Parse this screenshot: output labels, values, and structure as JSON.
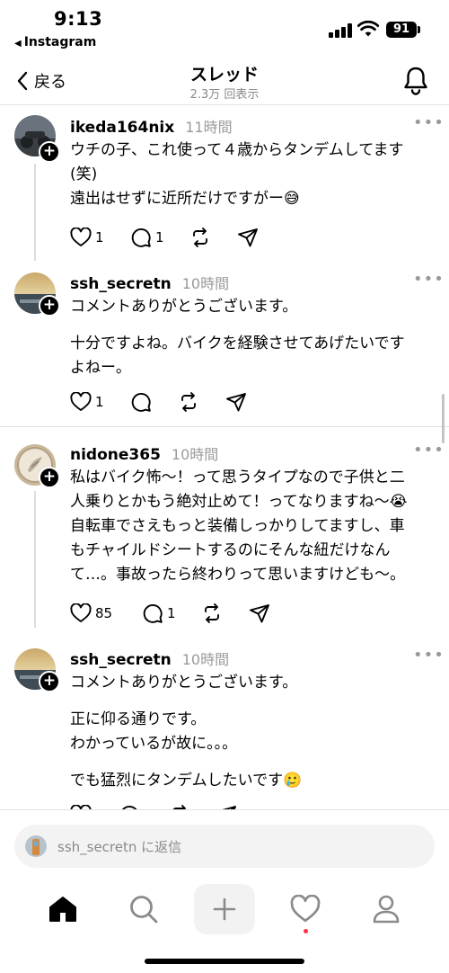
{
  "status_bar": {
    "time": "9:13",
    "back_app": "Instagram",
    "battery": "91"
  },
  "header": {
    "back_label": "戻る",
    "title": "スレッド",
    "views": "2.3万 回表示"
  },
  "posts": [
    {
      "username": "ikeda164nix",
      "time": "11時間",
      "lines": [
        "ウチの子、これ使って４歳からタンデムしてます",
        "(笑)",
        "遠出はせずに近所だけですがー😅"
      ],
      "likes": "1",
      "replies": "1"
    },
    {
      "username": "ssh_secretn",
      "time": "10時間",
      "lines": [
        "コメントありがとうございます。",
        "",
        "十分ですよね。バイクを経験させてあげたいです",
        "よねー。"
      ],
      "likes": "1",
      "replies": ""
    },
    {
      "username": "nidone365",
      "time": "10時間",
      "lines": [
        "私はバイク怖〜！って思うタイプなので子供と二",
        "人乗りとかもう絶対止めて！ってなりますね〜😭",
        "自転車でさえもっと装備しっかりしてますし、車",
        "もチャイルドシートするのにそんな紐だけなん",
        "て…。事故ったら終わりって思いますけども〜。"
      ],
      "likes": "85",
      "replies": "1"
    },
    {
      "username": "ssh_secretn",
      "time": "10時間",
      "lines": [
        "コメントありがとうございます。",
        "",
        "正に仰る通りです。",
        "わかっているが故に。。。",
        "",
        "でも猛烈にタンデムしたいです🥲"
      ],
      "likes": "",
      "replies": ""
    }
  ],
  "reply_bar": {
    "placeholder": "ssh_secretn に返信"
  },
  "tab_bar": {
    "items": [
      "home-icon",
      "search-icon",
      "create-icon",
      "heart-icon",
      "profile-icon"
    ]
  },
  "colors": {
    "accent_dot": "#ff3040",
    "secondary_text": "#9a9a9a",
    "divider": "#e2e2e2"
  }
}
